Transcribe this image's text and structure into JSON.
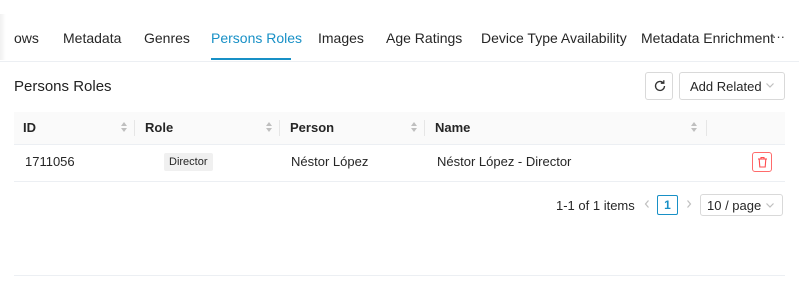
{
  "tabs": {
    "items": [
      "ows",
      "Metadata",
      "Genres",
      "Persons Roles",
      "Images",
      "Age Ratings",
      "Device Type Availability",
      "Metadata Enrichment"
    ],
    "active": "Persons Roles",
    "more_label": "···"
  },
  "section": {
    "title": "Persons Roles",
    "add_related_label": "Add Related",
    "refresh_icon": "refresh-icon"
  },
  "table": {
    "columns": [
      "ID",
      "Role",
      "Person",
      "Name"
    ],
    "rows": [
      {
        "id": "1711056",
        "role": "Director",
        "person": "Néstor López",
        "name": "Néstor López - Director"
      }
    ]
  },
  "pagination": {
    "total_text": "1-1 of 1 items",
    "current_page": "1",
    "page_size": "10 / page"
  },
  "colors": {
    "accent": "#1890c6",
    "danger": "#ff4d4f"
  }
}
